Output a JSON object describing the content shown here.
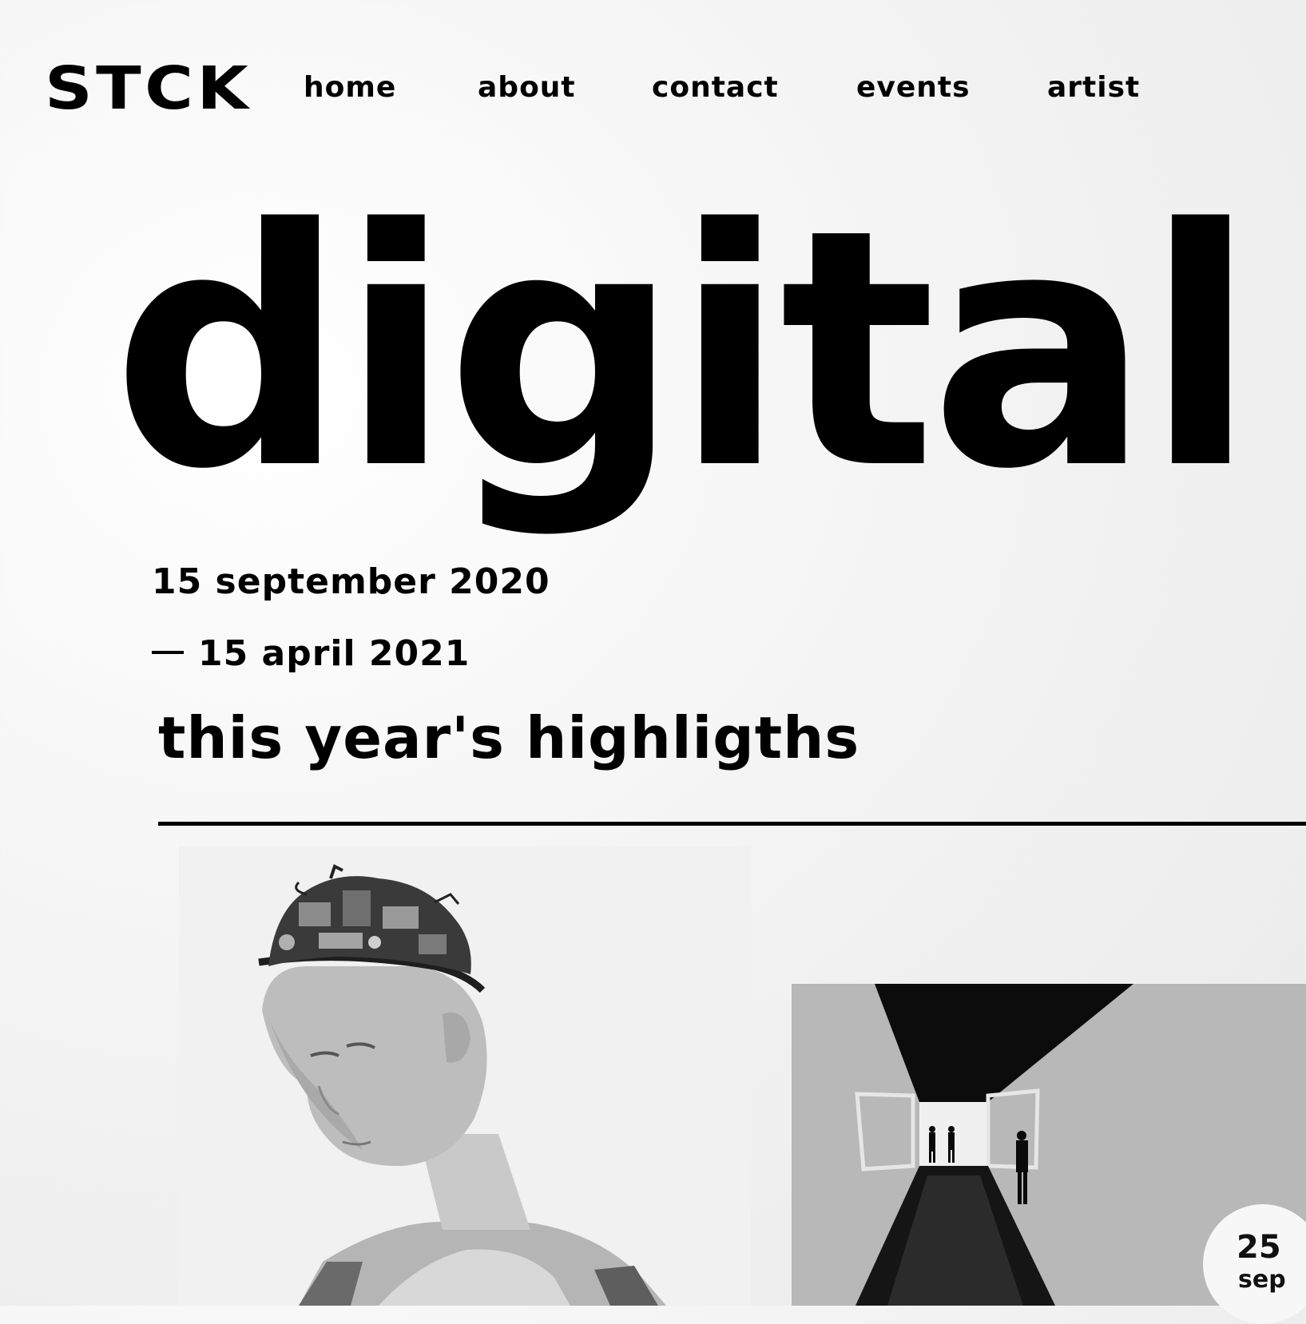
{
  "brand": {
    "logo": "STCK"
  },
  "nav": {
    "items": [
      {
        "label": "home"
      },
      {
        "label": "about"
      },
      {
        "label": "contact"
      },
      {
        "label": "events"
      },
      {
        "label": "artist"
      }
    ]
  },
  "hero": {
    "title": "digital",
    "date_start": "15 september 2020",
    "date_end": "15 april 2021",
    "section_heading": "this year's highligths"
  },
  "event_badge": {
    "day": "25",
    "month": "sep"
  },
  "colors": {
    "text": "#000000",
    "background": "#f2f2f2",
    "divider": "#000000"
  },
  "images": [
    {
      "subject": "humanoid robot with exposed mechanical head"
    },
    {
      "subject": "people in a dark gallery corridor"
    }
  ]
}
